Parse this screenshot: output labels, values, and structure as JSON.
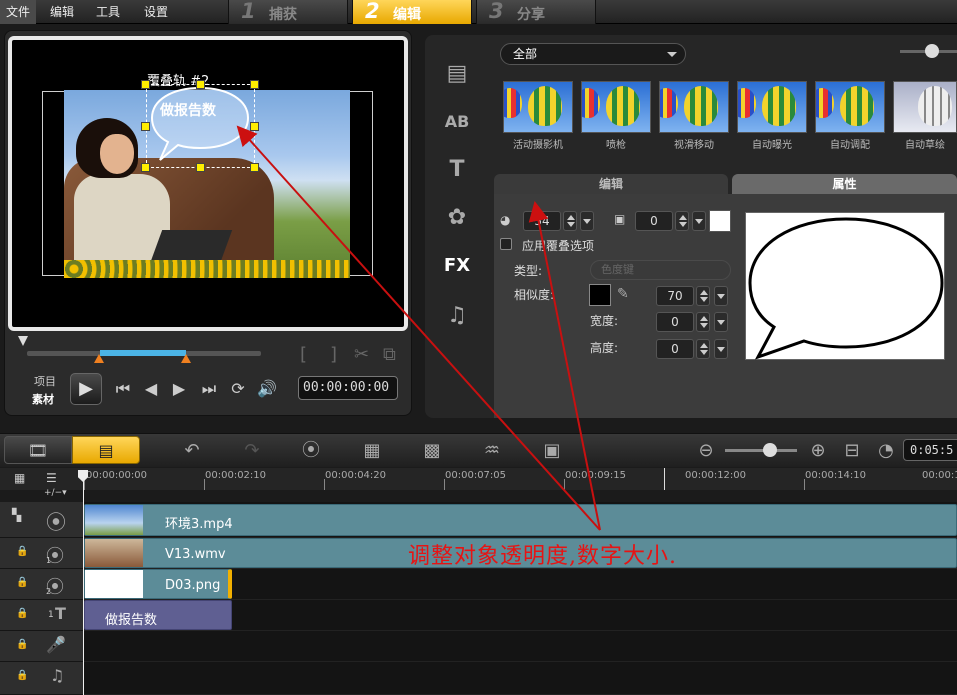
{
  "menu": {
    "file": "文件",
    "edit": "编辑",
    "tools": "工具",
    "settings": "设置"
  },
  "steps": [
    {
      "num": "1",
      "label": "捕获"
    },
    {
      "num": "2",
      "label": "编辑"
    },
    {
      "num": "3",
      "label": "分享"
    }
  ],
  "preview": {
    "overlay_label": "覆叠轨 #2",
    "bubble_text": "做报告数",
    "mode_project": "项目",
    "mode_clip": "素材",
    "timecode": "00:00:00:00"
  },
  "library": {
    "category": "全部",
    "thumbnails": [
      "活动摄影机",
      "喷枪",
      "视滑移动",
      "自动曝光",
      "自动调配",
      "自动草绘"
    ]
  },
  "options": {
    "tab_edit": "编辑",
    "tab_attributes": "属性",
    "opacity_value": "54",
    "border_value": "0",
    "apply_overlay_options": "应用覆叠选项",
    "type_label": "类型:",
    "type_value": "色度键",
    "similarity_label": "相似度:",
    "similarity_value": "70",
    "width_label": "宽度:",
    "width_value": "0",
    "height_label": "高度:",
    "height_value": "0"
  },
  "timeline": {
    "duration": "0:05:5",
    "ruler": [
      "00:00:00:00",
      "00:00:02:10",
      "00:00:04:20",
      "00:00:07:05",
      "00:00:09:15",
      "00:00:12:00",
      "00:00:14:10",
      "00:00:1"
    ],
    "tracks": [
      {
        "clip": "环境3.mp4"
      },
      {
        "clip": "V13.wmv",
        "badge": "1"
      },
      {
        "clip": "D03.png",
        "badge": "2"
      },
      {
        "clip": "做报告数",
        "badge": "1"
      }
    ]
  },
  "annotation": "调整对象透明度,数字大小."
}
